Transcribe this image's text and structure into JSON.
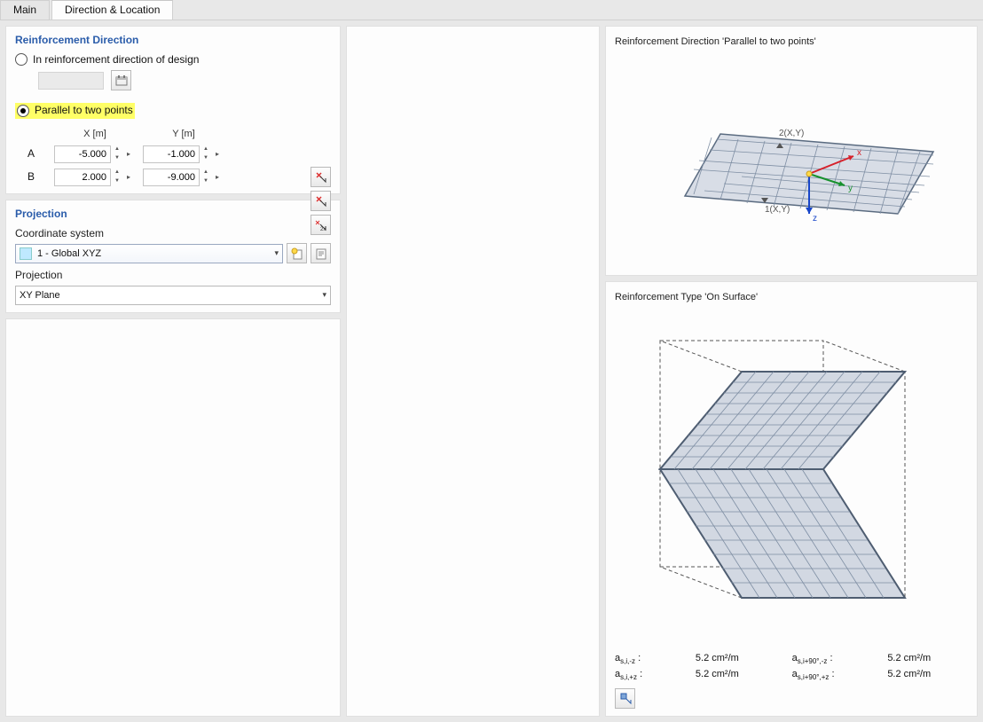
{
  "tabs": {
    "main": "Main",
    "dirloc": "Direction & Location"
  },
  "direction": {
    "title": "Reinforcement Direction",
    "opt_design": "In reinforcement direction of design",
    "opt_parallel": "Parallel to two points",
    "xhdr": "X [m]",
    "yhdr": "Y [m]",
    "rowA": "A",
    "rowB": "B",
    "ax": "-5.000",
    "ay": "-1.000",
    "bx": "2.000",
    "by": "-9.000"
  },
  "projection": {
    "title": "Projection",
    "cs_label": "Coordinate system",
    "cs_value": "1 - Global XYZ",
    "proj_label": "Projection",
    "proj_value": "XY Plane"
  },
  "preview1": {
    "title": "Reinforcement Direction 'Parallel to two points'",
    "p1": "1(X,Y)",
    "p2": "2(X,Y)",
    "ax_x": "x",
    "ax_y": "y",
    "ax_z": "z"
  },
  "preview2": {
    "title": "Reinforcement Type 'On Surface'",
    "r1l": "a",
    "r1s": "s,i,-z",
    "r1c": ":",
    "r1v": "5.2 cm²/m",
    "r2l": "a",
    "r2s": "s,i,+z",
    "r2c": ":",
    "r2v": "5.2 cm²/m",
    "r3l": "a",
    "r3s": "s,i+90°,-z",
    "r3c": ":",
    "r3v": "5.2 cm²/m",
    "r4l": "a",
    "r4s": "s,i+90°,+z",
    "r4c": ":",
    "r4v": "5.2 cm²/m"
  }
}
